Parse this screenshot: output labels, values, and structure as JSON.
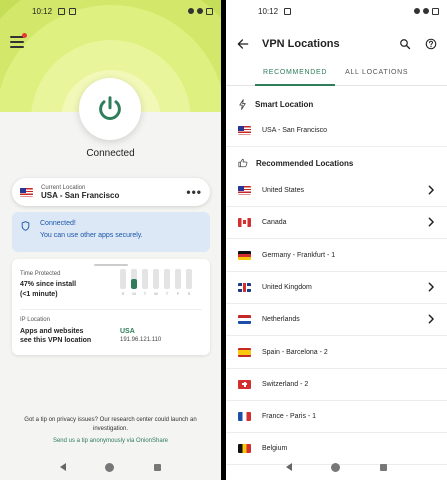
{
  "left": {
    "status": {
      "time": "10:12"
    },
    "connection_status": "Connected",
    "current_location": {
      "label": "Current Location",
      "value": "USA - San Francisco"
    },
    "notice": {
      "title": "Connected!",
      "body": "You can use other apps securely."
    },
    "time_protected": {
      "label": "Time Protected",
      "line1": "47% since install",
      "line2": "(<1 minute)",
      "days": [
        "S",
        "M",
        "T",
        "W",
        "T",
        "F",
        "S"
      ],
      "today_index": 1,
      "today_fraction": 0.5
    },
    "ip_location": {
      "label": "IP Location",
      "line1": "Apps and websites",
      "line2": "see this VPN location",
      "country": "USA",
      "ip": "191.96.121.110"
    },
    "tip": "Got a tip on privacy issues? Our research center could launch an investigation.",
    "tip_link": "Send us a tip anonymously via OnionShare"
  },
  "right": {
    "status": {
      "time": "10:12"
    },
    "title": "VPN Locations",
    "tabs": {
      "recommended": "RECOMMENDED",
      "all": "ALL LOCATIONS"
    },
    "smart_location": {
      "header": "Smart Location",
      "item": "USA - San Francisco"
    },
    "recommended": {
      "header": "Recommended Locations",
      "items": [
        {
          "name": "United States"
        },
        {
          "name": "Canada"
        },
        {
          "name": "Germany - Frankfurt - 1"
        },
        {
          "name": "United Kingdom"
        },
        {
          "name": "Netherlands"
        },
        {
          "name": "Spain - Barcelona - 2"
        },
        {
          "name": "Switzerland - 2"
        },
        {
          "name": "France - Paris - 1"
        },
        {
          "name": "Belgium"
        }
      ]
    }
  },
  "colors": {
    "brand_green": "#2e7d5b",
    "hero_lime": "#c5de58",
    "notice_blue": "#1a56a8"
  }
}
